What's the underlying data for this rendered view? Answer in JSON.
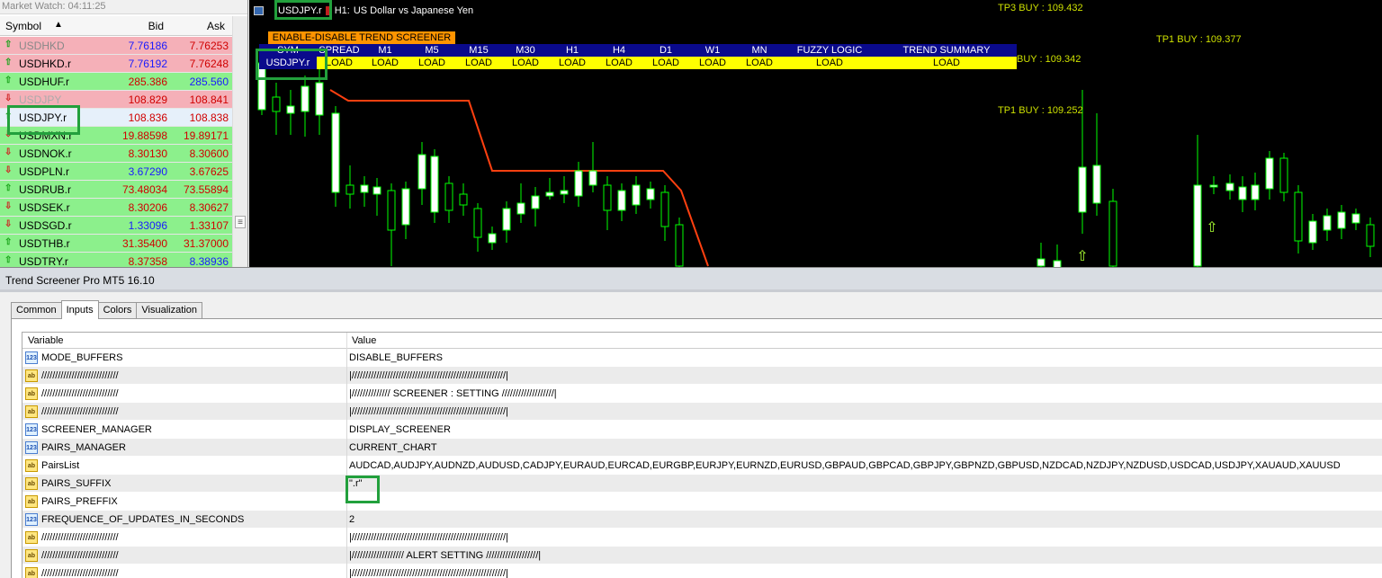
{
  "market_watch": {
    "title": "Market Watch: 04:11:25",
    "col_symbol": "Symbol",
    "col_bid": "Bid",
    "col_ask": "Ask",
    "rows": [
      {
        "symbol": "USDHKD",
        "bid": "7.76186",
        "ask": "7.76253",
        "dir": "up",
        "row_color": "red",
        "text_color": "#888888",
        "bid_color": "#1a1aff",
        "ask_color": "#d00000"
      },
      {
        "symbol": "USDHKD.r",
        "bid": "7.76192",
        "ask": "7.76248",
        "dir": "up",
        "row_color": "red",
        "text_color": "#000000",
        "bid_color": "#1a1aff",
        "ask_color": "#d00000"
      },
      {
        "symbol": "USDHUF.r",
        "bid": "285.386",
        "ask": "285.560",
        "dir": "up",
        "row_color": "green",
        "text_color": "#000000",
        "bid_color": "#d00000",
        "ask_color": "#1a1aff"
      },
      {
        "symbol": "USDJPY",
        "bid": "108.829",
        "ask": "108.841",
        "dir": "down",
        "row_color": "red",
        "text_color": "#aaaaaa",
        "bid_color": "#d00000",
        "ask_color": "#d00000"
      },
      {
        "symbol": "USDJPY.r",
        "bid": "108.836",
        "ask": "108.838",
        "dir": "up",
        "row_color": "sel",
        "text_color": "#000000",
        "bid_color": "#d00000",
        "ask_color": "#d00000"
      },
      {
        "symbol": "USDMXN.r",
        "bid": "19.88598",
        "ask": "19.89171",
        "dir": "down",
        "row_color": "green",
        "text_color": "#000000",
        "bid_color": "#d00000",
        "ask_color": "#d00000"
      },
      {
        "symbol": "USDNOK.r",
        "bid": "8.30130",
        "ask": "8.30600",
        "dir": "down",
        "row_color": "green",
        "text_color": "#000000",
        "bid_color": "#d00000",
        "ask_color": "#d00000"
      },
      {
        "symbol": "USDPLN.r",
        "bid": "3.67290",
        "ask": "3.67625",
        "dir": "down",
        "row_color": "green",
        "text_color": "#000000",
        "bid_color": "#1a1aff",
        "ask_color": "#d00000"
      },
      {
        "symbol": "USDRUB.r",
        "bid": "73.48034",
        "ask": "73.55894",
        "dir": "up",
        "row_color": "green",
        "text_color": "#000000",
        "bid_color": "#d00000",
        "ask_color": "#d00000"
      },
      {
        "symbol": "USDSEK.r",
        "bid": "8.30206",
        "ask": "8.30627",
        "dir": "down",
        "row_color": "green",
        "text_color": "#000000",
        "bid_color": "#d00000",
        "ask_color": "#d00000"
      },
      {
        "symbol": "USDSGD.r",
        "bid": "1.33096",
        "ask": "1.33107",
        "dir": "down",
        "row_color": "green",
        "text_color": "#000000",
        "bid_color": "#1a1aff",
        "ask_color": "#d00000"
      },
      {
        "symbol": "USDTHB.r",
        "bid": "31.35400",
        "ask": "31.37000",
        "dir": "up",
        "row_color": "green",
        "text_color": "#000000",
        "bid_color": "#d00000",
        "ask_color": "#d00000"
      },
      {
        "symbol": "USDTRY.r",
        "bid": "8.37358",
        "ask": "8.38936",
        "dir": "up",
        "row_color": "green",
        "text_color": "#000000",
        "bid_color": "#d00000",
        "ask_color": "#1a1aff"
      }
    ]
  },
  "chart": {
    "symbol": "USDJPY.r",
    "timeframe": "H1",
    "description": "US Dollar vs Japanese Yen",
    "tp_labels": [
      {
        "text": "TP3 BUY : 109.432"
      },
      {
        "text": "TP1 BUY : 109.377"
      },
      {
        "text": "BUY : 109.342"
      },
      {
        "text": "TP1 BUY : 109.252"
      }
    ],
    "screener_toggle": "ENABLE-DISABLE TREND SCREENER",
    "screener_headers": [
      "SYM",
      "SPREAD",
      "M1",
      "M5",
      "M15",
      "M30",
      "H1",
      "H4",
      "D1",
      "W1",
      "MN",
      "FUZZY LOGIC",
      "TREND SUMMARY"
    ],
    "screener_row": {
      "symbol": "USDJPY.r",
      "cells": [
        "LOAD",
        "LOAD",
        "LOAD",
        "LOAD",
        "LOAD",
        "LOAD",
        "LOAD",
        "LOAD",
        "LOAD",
        "LOAD",
        "LOAD",
        "LOAD"
      ]
    },
    "colors": {
      "bull": "#ffffff",
      "bear": "#000000",
      "wick": "#00ff00",
      "trend_line": "#ff4010",
      "arrow": "#aaff33"
    }
  },
  "dialog": {
    "title": "Trend Screener Pro MT5 16.10",
    "tabs": [
      "Common",
      "Inputs",
      "Colors",
      "Visualization"
    ],
    "active_tab": "Inputs",
    "col_variable": "Variable",
    "col_value": "Value",
    "rows": [
      {
        "type": "num",
        "variable": "MODE_BUFFERS",
        "value": "DISABLE_BUFFERS"
      },
      {
        "type": "ab",
        "variable": "////////////////////////////",
        "value": "|////////////////////////////////////////////////////////|"
      },
      {
        "type": "ab",
        "variable": "////////////////////////////",
        "value": "|////////////// SCREENER : SETTING ///////////////////|"
      },
      {
        "type": "ab",
        "variable": "////////////////////////////",
        "value": "|////////////////////////////////////////////////////////|"
      },
      {
        "type": "num",
        "variable": "SCREENER_MANAGER",
        "value": "DISPLAY_SCREENER"
      },
      {
        "type": "num",
        "variable": "PAIRS_MANAGER",
        "value": "CURRENT_CHART"
      },
      {
        "type": "ab",
        "variable": "PairsList",
        "value": "AUDCAD,AUDJPY,AUDNZD,AUDUSD,CADJPY,EURAUD,EURCAD,EURGBP,EURJPY,EURNZD,EURUSD,GBPAUD,GBPCAD,GBPJPY,GBPNZD,GBPUSD,NZDCAD,NZDJPY,NZDUSD,USDCAD,USDJPY,XAUAUD,XAUUSD"
      },
      {
        "type": "ab",
        "variable": "PAIRS_SUFFIX",
        "value": "\".r\""
      },
      {
        "type": "ab",
        "variable": "PAIRS_PREFFIX",
        "value": ""
      },
      {
        "type": "num",
        "variable": "FREQUENCE_OF_UPDATES_IN_SECONDS",
        "value": "2"
      },
      {
        "type": "ab",
        "variable": "////////////////////////////",
        "value": "|////////////////////////////////////////////////////////|"
      },
      {
        "type": "ab",
        "variable": "////////////////////////////",
        "value": "|/////////////////// ALERT SETTING ///////////////////|"
      },
      {
        "type": "ab",
        "variable": "////////////////////////////",
        "value": "|////////////////////////////////////////////////////////|"
      }
    ]
  }
}
